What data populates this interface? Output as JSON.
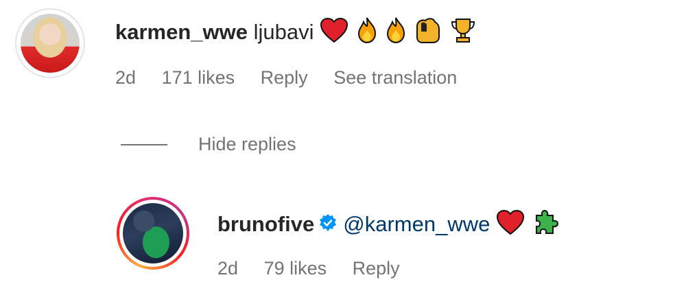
{
  "comment": {
    "username": "karmen_wwe",
    "text": "ljubavi",
    "emojis": [
      "red-heart",
      "fire",
      "fire",
      "flexed-biceps",
      "trophy"
    ],
    "time": "2d",
    "likes": "171 likes",
    "reply_label": "Reply",
    "translate_label": "See translation"
  },
  "replies_toggle": {
    "label": "Hide replies"
  },
  "reply": {
    "username": "brunofive",
    "verified": true,
    "mention": "@karmen_wwe",
    "emojis": [
      "red-heart",
      "green-puzzle-piece"
    ],
    "time": "2d",
    "likes": "79 likes",
    "reply_label": "Reply"
  },
  "colors": {
    "username": "#262626",
    "secondary_text": "#737373",
    "mention": "#00376b",
    "verified_badge": "#0095f6",
    "story_ring": [
      "#fcaf45",
      "#fd1d1d",
      "#e1306c",
      "#c13584"
    ]
  }
}
